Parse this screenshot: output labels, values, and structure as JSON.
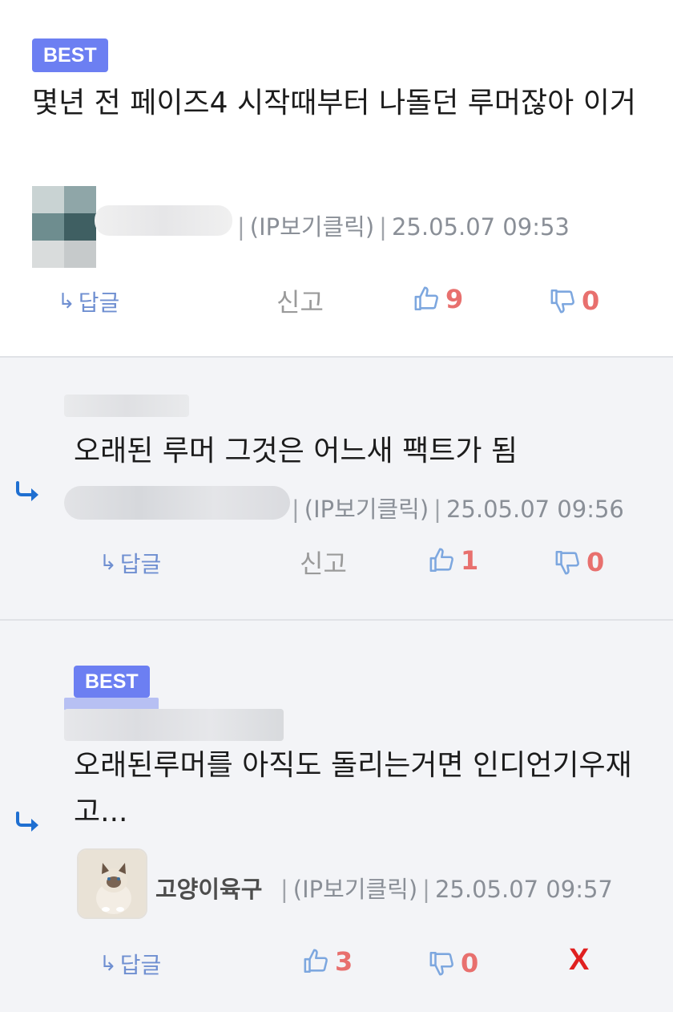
{
  "comments": [
    {
      "best_label": "BEST",
      "content": "몇년 전 페이즈4 시작때부터 나돌던 루머잖아 이거",
      "ip_label": "(IP보기클릭)",
      "timestamp": "25.05.07 09:53",
      "reply_label": "답글",
      "report_label": "신고",
      "likes": "9",
      "dislikes": "0"
    },
    {
      "content": "오래된 루머 그것은 어느새 팩트가 됨",
      "ip_label": "(IP보기클릭)",
      "timestamp": "25.05.07 09:56",
      "reply_label": "답글",
      "report_label": "신고",
      "likes": "1",
      "dislikes": "0"
    },
    {
      "best_label": "BEST",
      "content": "오래된루머를 아직도 돌리는거면 인디언기우재고...",
      "author": "고양이육구",
      "ip_label": "(IP보기클릭)",
      "timestamp": "25.05.07 09:57",
      "reply_label": "답글",
      "likes": "3",
      "dislikes": "0",
      "delete_label": "X"
    }
  ],
  "icons": {
    "reply_arrow": "reply-arrow-icon",
    "thumbs_up": "thumbs-up-icon",
    "thumbs_down": "thumbs-down-icon"
  },
  "colors": {
    "best_badge": "#6c7ff2",
    "count": "#e8706e",
    "thumb_icon": "#7da7df",
    "reply_arrow": "#1f6fd1",
    "delete": "#e02020"
  }
}
